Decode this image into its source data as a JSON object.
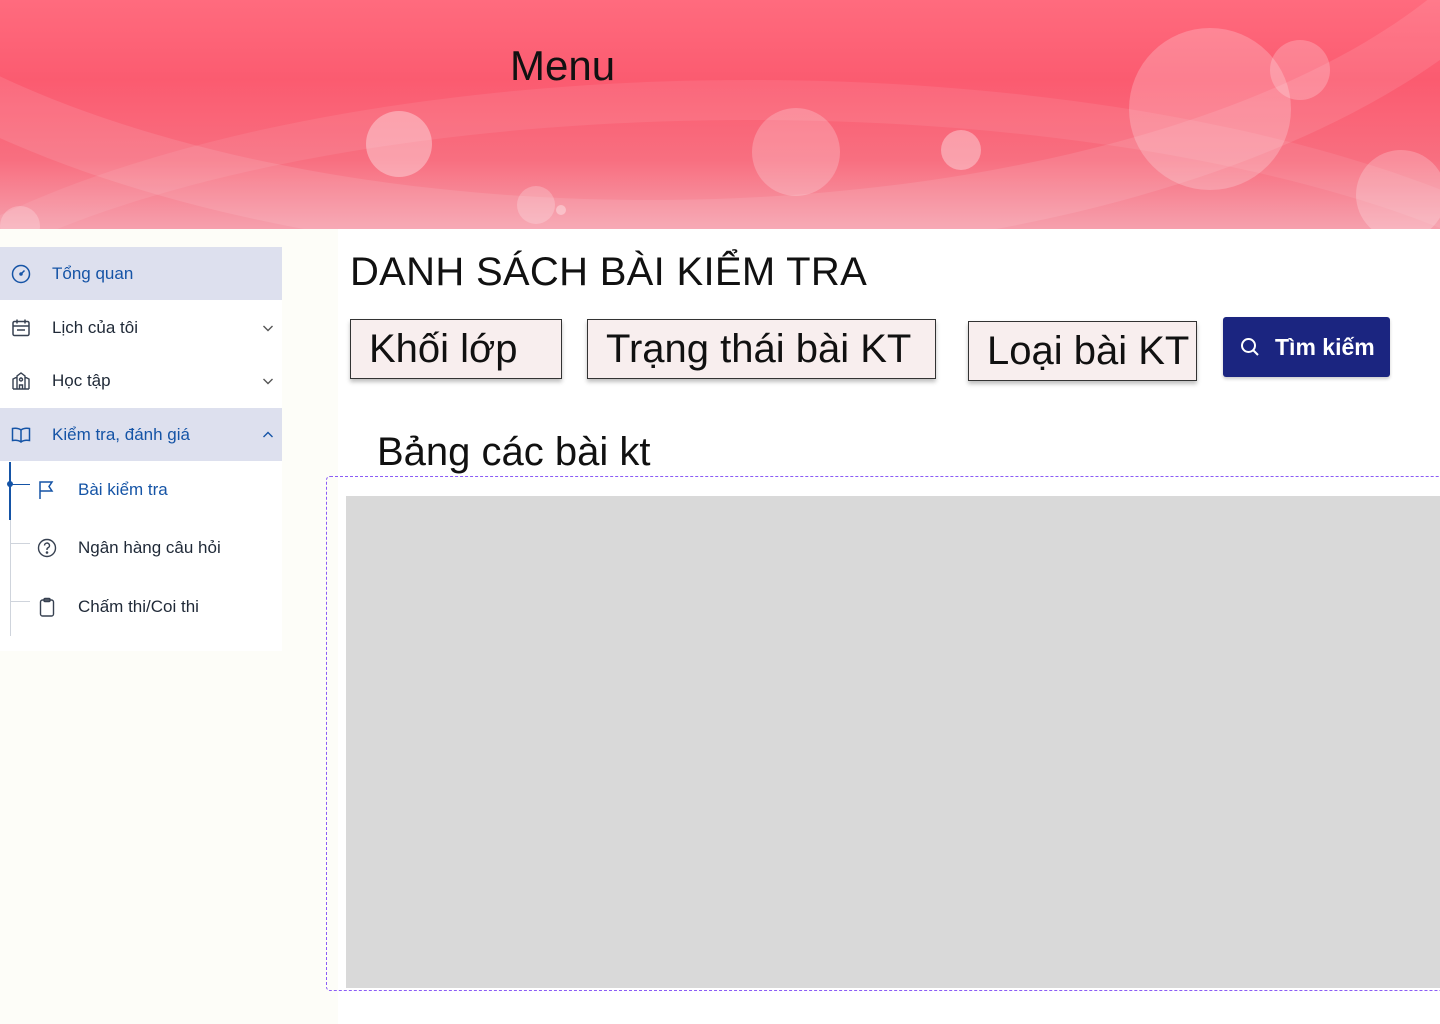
{
  "header": {
    "title": "Menu"
  },
  "sidebar": {
    "items": [
      {
        "label": "Tổng quan",
        "icon": "gauge-icon",
        "active": true
      },
      {
        "label": "Lịch của tôi",
        "icon": "calendar-icon",
        "expandable": true
      },
      {
        "label": "Học tập",
        "icon": "school-icon",
        "expandable": true
      },
      {
        "label": "Kiểm tra, đánh giá",
        "icon": "open-book-icon",
        "expanded": true,
        "active": true
      }
    ],
    "sub_items": [
      {
        "label": "Bài kiểm tra",
        "icon": "flag-icon",
        "active": true
      },
      {
        "label": "Ngân hàng câu hỏi",
        "icon": "question-circle-icon"
      },
      {
        "label": "Chấm thi/Coi thi",
        "icon": "clipboard-icon"
      }
    ]
  },
  "main": {
    "title": "DANH SÁCH BÀI KIỂM TRA",
    "filters": {
      "grade": "Khối lớp",
      "status": "Trạng thái bài KT",
      "type": "Loại bài KT"
    },
    "search_label": "Tìm kiếm",
    "table_heading": "Bảng các bài kt"
  },
  "colors": {
    "accent": "#1554a6",
    "active_bg": "#dde0ee",
    "search_button": "#1b2580",
    "banner": "#fb5b70",
    "table_placeholder": "#d9d9d9",
    "frame_border": "#8b5cf6"
  }
}
